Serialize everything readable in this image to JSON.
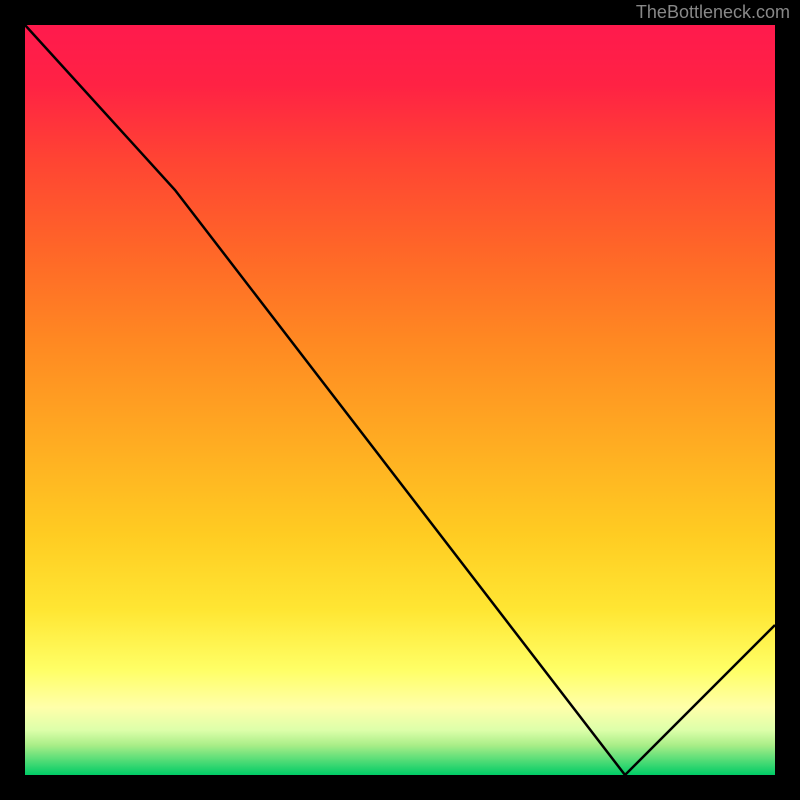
{
  "watermark": "TheBottleneck.com",
  "annotation_label": "",
  "chart_data": {
    "type": "line",
    "title": "",
    "xlabel": "",
    "ylabel": "",
    "xlim": [
      0,
      100
    ],
    "ylim": [
      0,
      100
    ],
    "x": [
      0,
      20,
      80,
      100
    ],
    "values": [
      100,
      78,
      0,
      20
    ],
    "annotation_x": 80,
    "annotation_y": 0,
    "gradient_colors": {
      "top": "#ff1744",
      "mid_upper": "#ff5533",
      "middle": "#ffaa22",
      "mid_lower": "#ffdd33",
      "lower": "#ffff88",
      "low_green": "#88ee77",
      "bottom": "#00dd66"
    }
  }
}
